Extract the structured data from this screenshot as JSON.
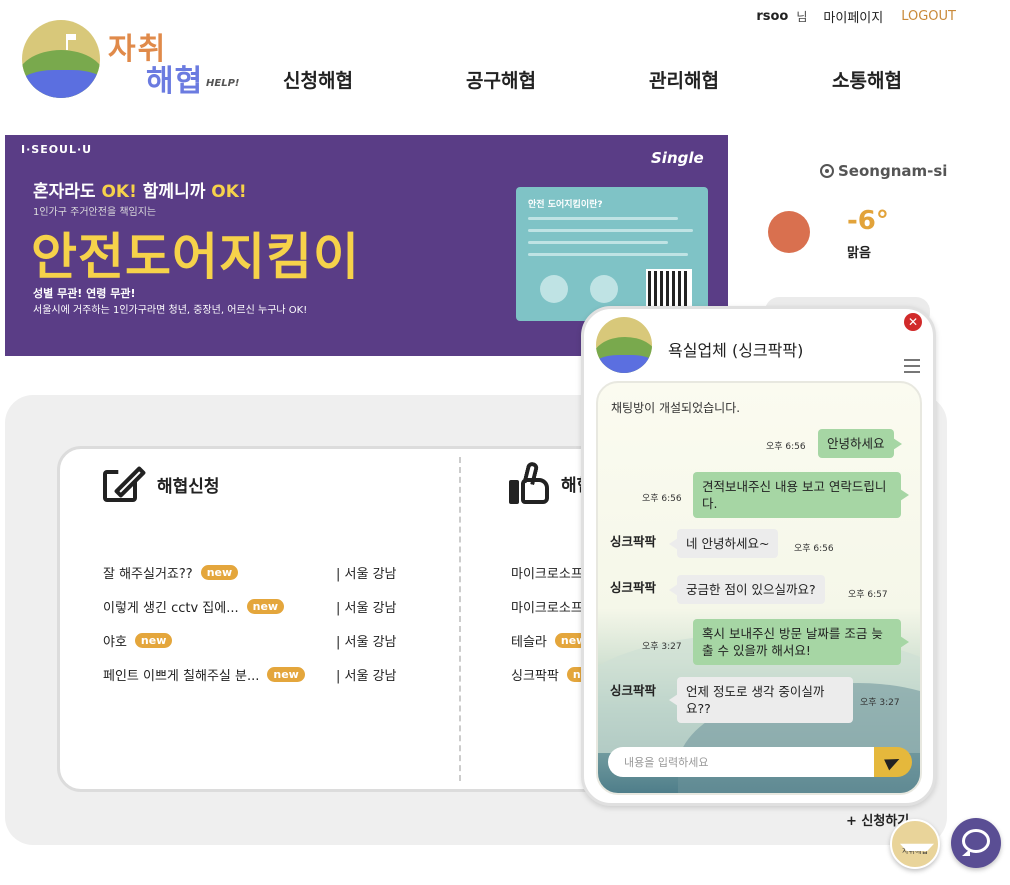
{
  "logo": {
    "line1": "자취",
    "line2": "해협",
    "help": "HELP!"
  },
  "topbar": {
    "user": "rsoo",
    "honorific": "님",
    "mypage": "마이페이지",
    "logout": "LOGOUT"
  },
  "nav": [
    "신청해협",
    "공구해협",
    "관리해협",
    "소통해협"
  ],
  "banner": {
    "seoul": "I·SEOUL·U",
    "single": "Single",
    "sub1a": "혼자라도 ",
    "sub1b": "OK!",
    "sub1c": " 함께니까 ",
    "sub1d": "OK!",
    "sub2": "1인가구 주거안전을 책임지는",
    "main": "안전도어지킴이",
    "foot1": "성별 무관! 연령 무관!",
    "foot2": "서울시에 거주하는 1인가구라면 청년, 중장년, 어르신 누구나 OK!",
    "card_title": "안전 도어지킴이란?"
  },
  "weather": {
    "location": "Seongnam-si",
    "temp": "-6°",
    "desc": "맑음"
  },
  "sections": {
    "request_title": "해협신청",
    "right_title": "해협",
    "badge": "new",
    "requests": [
      {
        "title": "잘 해주실거죠??",
        "loc": "| 서울 강남"
      },
      {
        "title": "이렇게 생긴 cctv 집에...",
        "loc": "| 서울 강남"
      },
      {
        "title": "야호",
        "loc": "| 서울 강남"
      },
      {
        "title": "페인트 이쁘게 칠해주실 분...",
        "loc": "| 서울 강남"
      }
    ],
    "companies": [
      "마이크로소프트",
      "마이크로소프트",
      "테슬라",
      "싱크팍팍"
    ]
  },
  "apply_link": "+ 신청하기",
  "chat": {
    "name": "욕실업체 (싱크팍팍)",
    "opened": "채팅방이 개설되었습니다.",
    "sender": "싱크팍팍",
    "placeholder": "내용을 입력하세요",
    "messages": [
      {
        "text": "안녕하세요",
        "time": "오후 6:56"
      },
      {
        "text": "견적보내주신 내용 보고 연락드립니다.",
        "time": "오후 6:56"
      },
      {
        "text": "네 안녕하세요~",
        "time": "오후 6:56"
      },
      {
        "text": "궁금한 점이 있으실까요?",
        "time": "오후 6:57"
      },
      {
        "text": "혹시 보내주신 방문 날짜를 조금 늦출 수 있을까 해서요!",
        "time": "오후 3:27"
      },
      {
        "text": "언제 정도로 생각 중이실까요??",
        "time": "오후 3:27"
      }
    ]
  },
  "fab_logo": "자취해협",
  "colors": {
    "accent": "#e4a63c",
    "banner": "#5a3d86",
    "chat_me": "#a6d6a4",
    "fab": "#5a4e94"
  }
}
